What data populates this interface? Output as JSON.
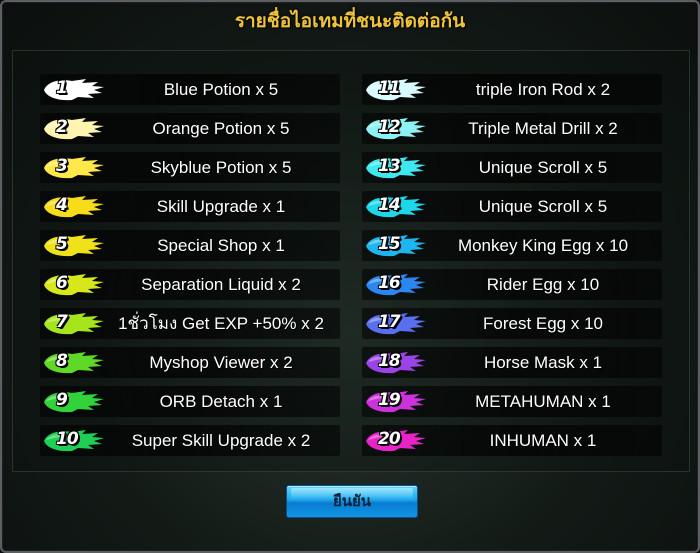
{
  "dialog": {
    "title": "รายชื่อไอเทมที่ชนะติดต่อกัน",
    "confirm_label": "ยืนยัน"
  },
  "left_items": [
    {
      "rank": "1",
      "label": "Blue Potion x 5",
      "color": "#ffffff"
    },
    {
      "rank": "2",
      "label": "Orange Potion x 5",
      "color": "#fff4b0"
    },
    {
      "rank": "3",
      "label": "Skyblue Potion x 5",
      "color": "#ffe84a"
    },
    {
      "rank": "4",
      "label": "Skill Upgrade x 1",
      "color": "#f7dc1c"
    },
    {
      "rank": "5",
      "label": "Special Shop x 1",
      "color": "#efe21a"
    },
    {
      "rank": "6",
      "label": "Separation Liquid x 2",
      "color": "#d6e81c"
    },
    {
      "rank": "7",
      "label": "1ชั่วโมง Get EXP +50% x 2",
      "color": "#a6e41c"
    },
    {
      "rank": "8",
      "label": "Myshop Viewer x 2",
      "color": "#5fd928"
    },
    {
      "rank": "9",
      "label": "ORB Detach x 1",
      "color": "#32d23a"
    },
    {
      "rank": "10",
      "label": "Super Skill Upgrade x 2",
      "color": "#1fcf55"
    }
  ],
  "right_items": [
    {
      "rank": "11",
      "label": "triple Iron Rod x 2",
      "color": "#d8fbff"
    },
    {
      "rank": "12",
      "label": "Triple Metal Drill x 2",
      "color": "#8ef2f4"
    },
    {
      "rank": "13",
      "label": "Unique Scroll x 5",
      "color": "#3fe8ef"
    },
    {
      "rank": "14",
      "label": "Unique Scroll x 5",
      "color": "#1cd6ea"
    },
    {
      "rank": "15",
      "label": "Monkey King Egg x 10",
      "color": "#1eb6ee"
    },
    {
      "rank": "16",
      "label": "Rider Egg x 10",
      "color": "#2a86f0"
    },
    {
      "rank": "17",
      "label": "Forest Egg x 10",
      "color": "#5a6ef0"
    },
    {
      "rank": "18",
      "label": "Horse Mask x 1",
      "color": "#9a44e8"
    },
    {
      "rank": "19",
      "label": "METAHUMAN x 1",
      "color": "#cc32dc"
    },
    {
      "rank": "20",
      "label": "INHUMAN x 1",
      "color": "#e824c8"
    }
  ]
}
